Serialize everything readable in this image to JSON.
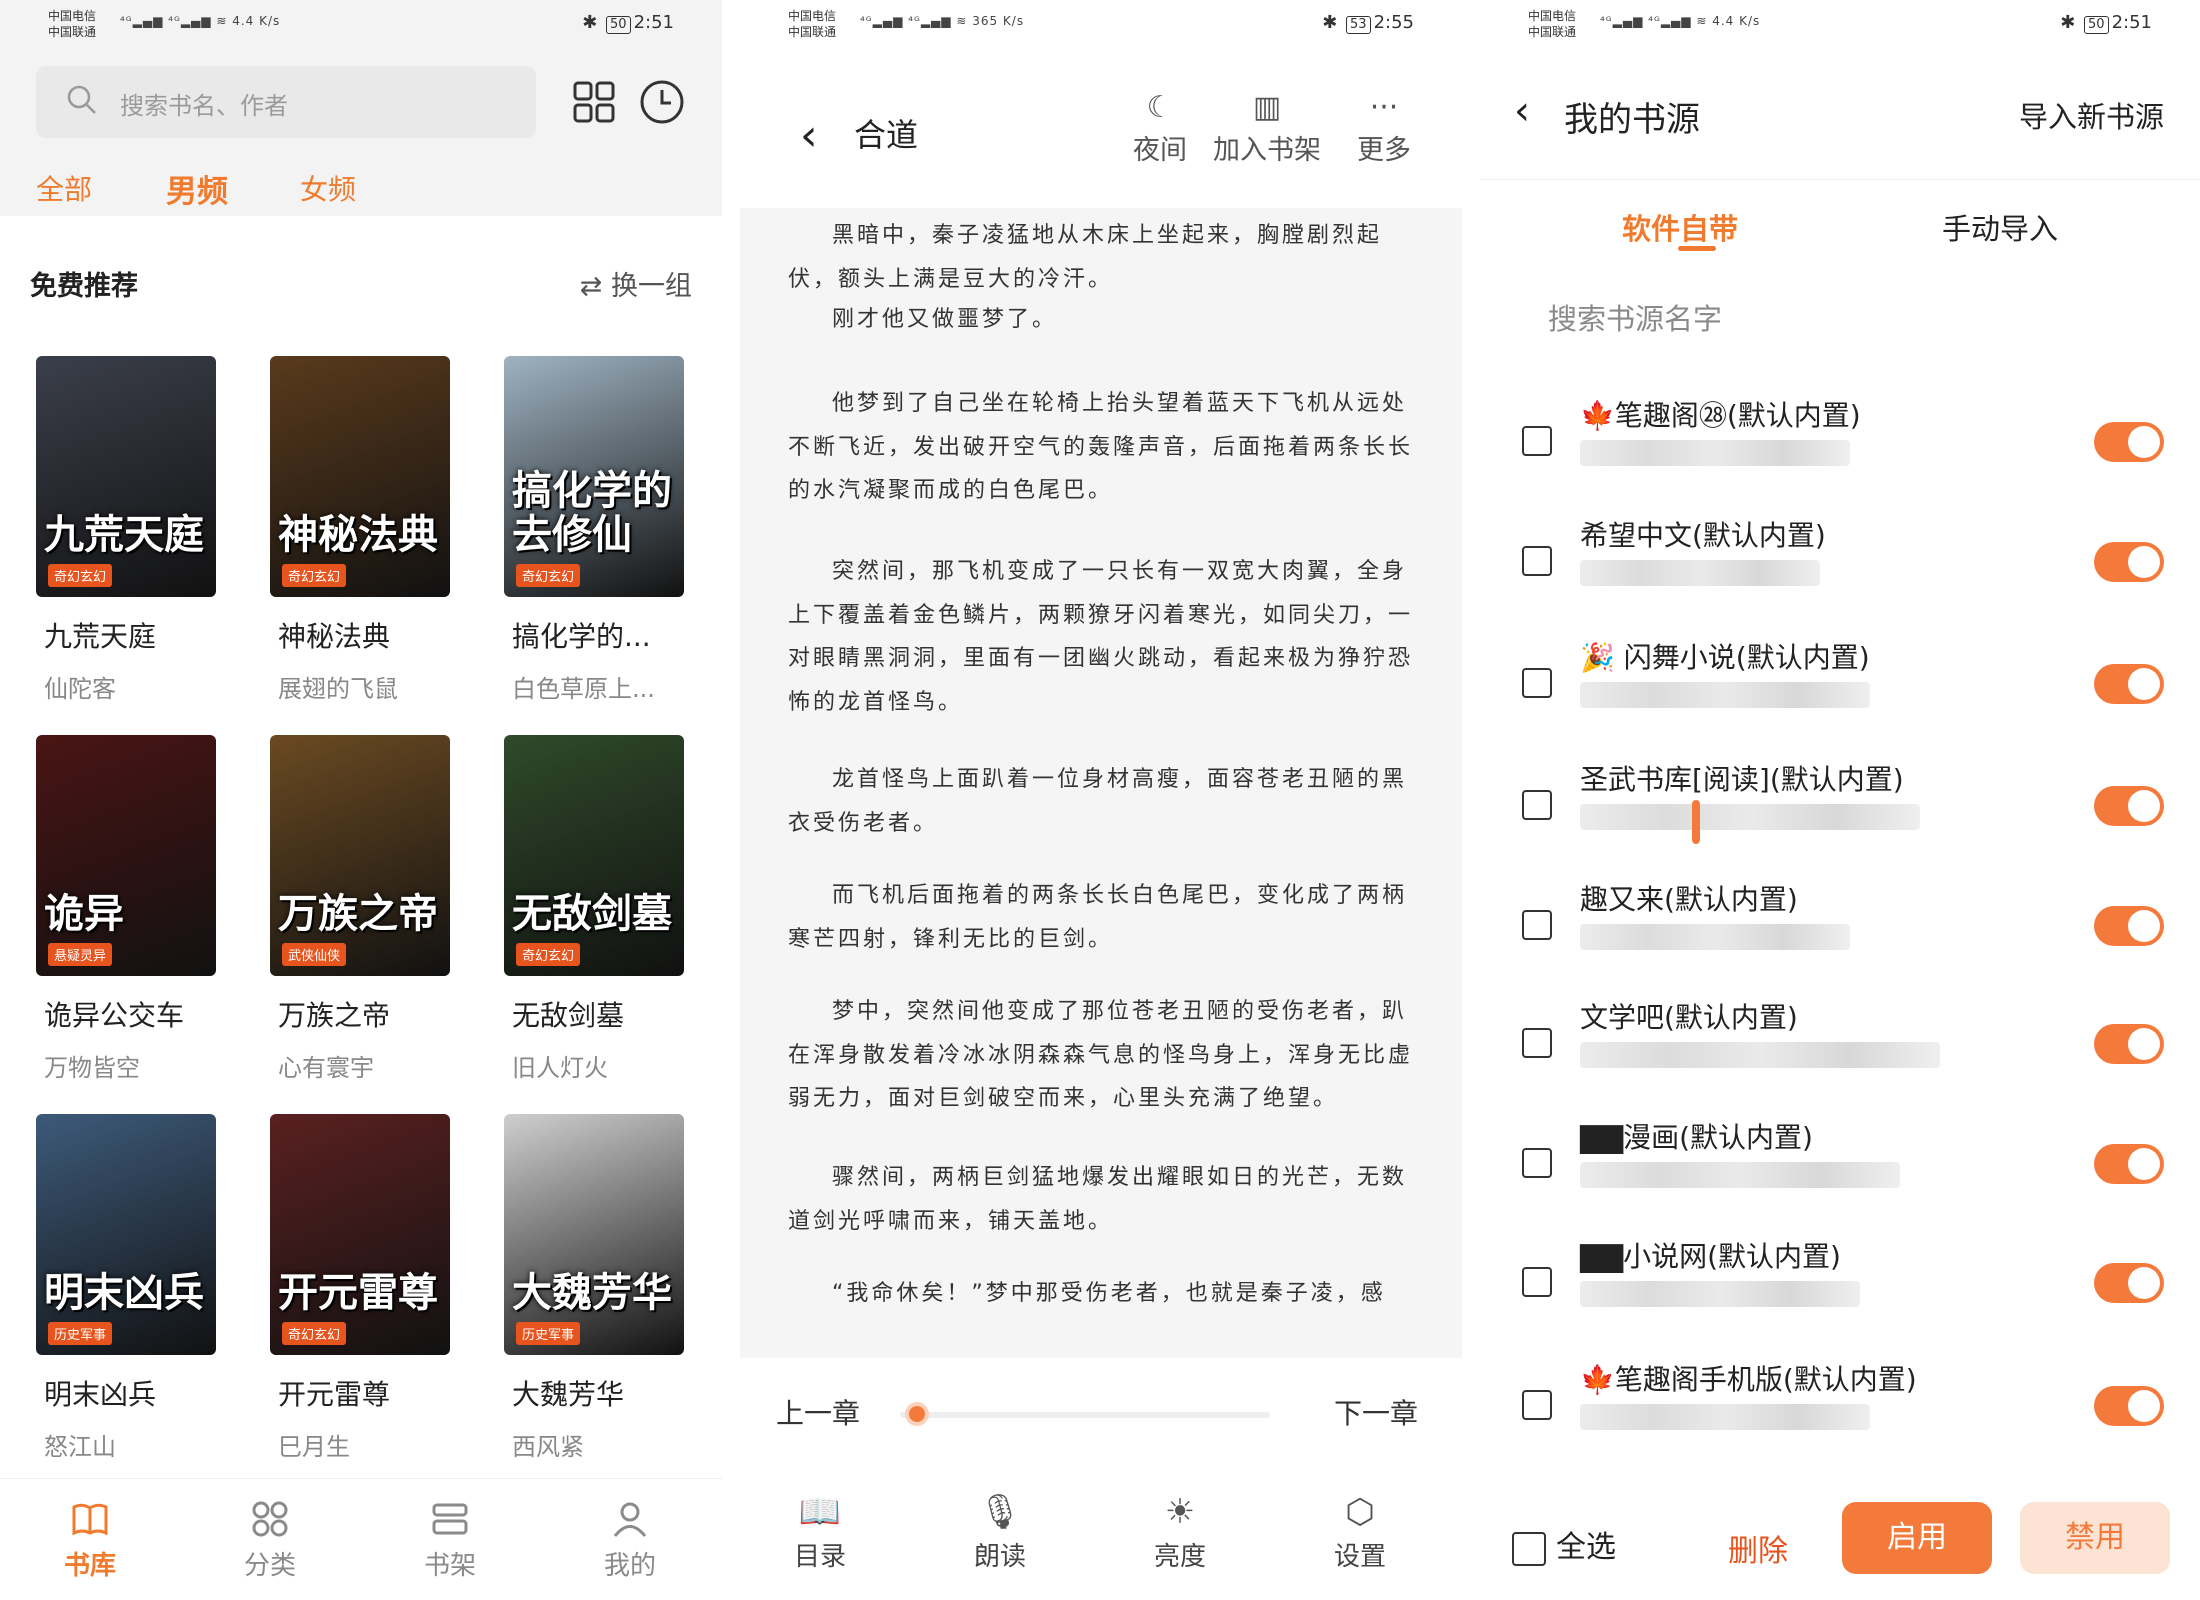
{
  "status_bars": [
    {
      "carrier1": "中国电信",
      "carrier2": "中国联通",
      "speed": "4.4 K/s",
      "battery": "50",
      "time": "2:51"
    },
    {
      "carrier1": "中国电信",
      "carrier2": "中国联通",
      "speed": "365 K/s",
      "battery": "53",
      "time": "2:55"
    },
    {
      "carrier1": "中国电信",
      "carrier2": "中国联通",
      "speed": "4.4 K/s",
      "battery": "50",
      "time": "2:51"
    }
  ],
  "library": {
    "search_placeholder": "搜索书名、作者",
    "gender_tabs": [
      {
        "label": "全部"
      },
      {
        "label": "男频"
      },
      {
        "label": "女频"
      }
    ],
    "section_title": "免费推荐",
    "refresh_label": "换一组",
    "books": [
      {
        "title": "九荒天庭",
        "author": "仙陀客",
        "cover_text": "九荒天庭",
        "tag": "奇幻玄幻",
        "bg": "#3b3f4a"
      },
      {
        "title": "神秘法典",
        "author": "展翅的飞鼠",
        "cover_text": "神秘法典",
        "tag": "奇幻玄幻",
        "bg": "#5a3a1c"
      },
      {
        "title": "搞化学的...",
        "author": "白色草原上...",
        "cover_text": "搞化学的去修仙",
        "tag": "奇幻玄幻",
        "bg": "#9fb3c2"
      },
      {
        "title": "诡异公交车",
        "author": "万物皆空",
        "cover_text": "诡异",
        "tag": "悬疑灵异",
        "bg": "#4a1414"
      },
      {
        "title": "万族之帝",
        "author": "心有寰宇",
        "cover_text": "万族之帝",
        "tag": "武侠仙侠",
        "bg": "#6b4a22"
      },
      {
        "title": "无敌剑墓",
        "author": "旧人灯火",
        "cover_text": "无敌剑墓",
        "tag": "奇幻玄幻",
        "bg": "#2f4a2a"
      },
      {
        "title": "明末凶兵",
        "author": "怒江山",
        "cover_text": "明末凶兵",
        "tag": "历史军事",
        "bg": "#3d5a7a"
      },
      {
        "title": "开元雷尊",
        "author": "巳月生",
        "cover_text": "开元雷尊",
        "tag": "奇幻玄幻",
        "bg": "#5a2020"
      },
      {
        "title": "大魏芳华",
        "author": "西风紧",
        "cover_text": "大魏芳华",
        "tag": "历史军事",
        "bg": "#cfcfcf"
      }
    ],
    "nav": [
      {
        "label": "书库"
      },
      {
        "label": "分类"
      },
      {
        "label": "书架"
      },
      {
        "label": "我的"
      }
    ]
  },
  "reader": {
    "title": "合道",
    "header_buttons": [
      {
        "label": "夜间"
      },
      {
        "label": "加入书架"
      },
      {
        "label": "更多"
      }
    ],
    "paragraphs": [
      "黑暗中，秦子凌猛地从木床上坐起来，胸膛剧烈起伏，额头上满是豆大的冷汗。",
      "刚才他又做噩梦了。",
      "他梦到了自己坐在轮椅上抬头望着蓝天下飞机从远处不断飞近，发出破开空气的轰隆声音，后面拖着两条长长的水汽凝聚而成的白色尾巴。",
      "突然间，那飞机变成了一只长有一双宽大肉翼，全身上下覆盖着金色鳞片，两颗獠牙闪着寒光，如同尖刀，一对眼睛黑洞洞，里面有一团幽火跳动，看起来极为狰狞恐怖的龙首怪鸟。",
      "龙首怪鸟上面趴着一位身材高瘦，面容苍老丑陋的黑衣受伤老者。",
      "而飞机后面拖着的两条长长白色尾巴，变化成了两柄寒芒四射，锋利无比的巨剑。",
      "梦中，突然间他变成了那位苍老丑陋的受伤老者，趴在浑身散发着冷冰冰阴森森气息的怪鸟身上，浑身无比虚弱无力，面对巨剑破空而来，心里头充满了绝望。",
      "骤然间，两柄巨剑猛地爆发出耀眼如日的光芒，无数道剑光呼啸而来，铺天盖地。",
      "“我命休矣！”梦中那受伤老者，也就是秦子凌，感"
    ],
    "prev_chapter": "上一章",
    "next_chapter": "下一章",
    "progress": 0.02,
    "tools": [
      {
        "label": "目录",
        "icon": "book-icon"
      },
      {
        "label": "朗读",
        "icon": "mic-icon"
      },
      {
        "label": "亮度",
        "icon": "brightness-icon"
      },
      {
        "label": "设置",
        "icon": "settings-icon"
      }
    ]
  },
  "sources": {
    "title": "我的书源",
    "import_label": "导入新书源",
    "tabs": [
      {
        "label": "软件自带"
      },
      {
        "label": "手动导入"
      }
    ],
    "search_placeholder": "搜索书源名字",
    "items": [
      {
        "name": "🍁笔趣阁㉘(默认内置)",
        "enabled": true
      },
      {
        "name": "希望中文(默认内置)",
        "enabled": true
      },
      {
        "name": "🎉 闪舞小说(默认内置)",
        "enabled": true
      },
      {
        "name": "圣武书库[阅读](默认内置)",
        "enabled": true
      },
      {
        "name": "趣又来(默认内置)",
        "enabled": true
      },
      {
        "name": "文学吧(默认内置)",
        "enabled": true
      },
      {
        "name": "▇▇漫画(默认内置)",
        "enabled": true
      },
      {
        "name": "▇▇小说网(默认内置)",
        "enabled": true
      },
      {
        "name": "🍁笔趣阁手机版(默认内置)",
        "enabled": true
      }
    ],
    "select_all": "全选",
    "delete": "删除",
    "enable": "启用",
    "disable": "禁用"
  },
  "colors": {
    "accent": "#f07b2e",
    "toggle": "#f47a3c",
    "disable_bg": "#fde3d3"
  }
}
